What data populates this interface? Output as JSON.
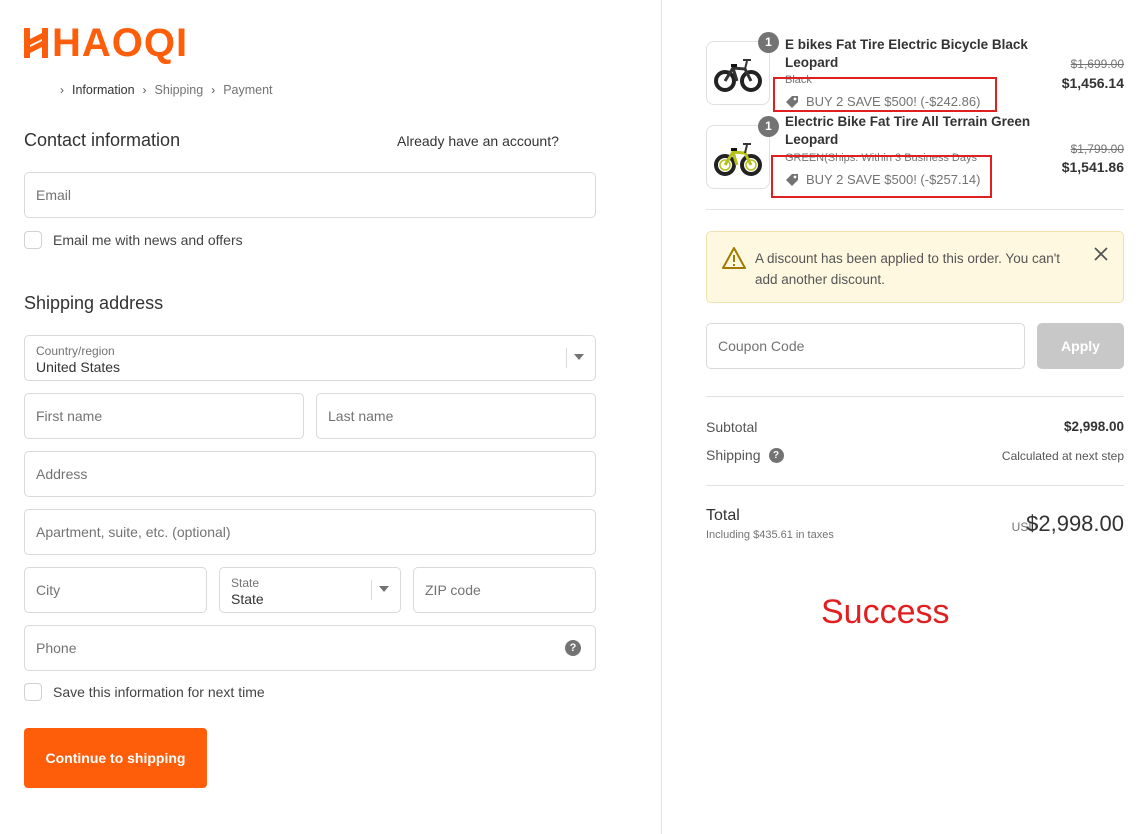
{
  "brand": {
    "name": "HAOQI",
    "color": "#fe5d0a"
  },
  "breadcrumb": [
    {
      "label": "Information",
      "active": true
    },
    {
      "label": "Shipping",
      "active": false
    },
    {
      "label": "Payment",
      "active": false
    }
  ],
  "contact": {
    "title": "Contact information",
    "login_prompt": "Already have an account?",
    "email_placeholder": "Email",
    "newsletter_label": "Email me with news and offers"
  },
  "shipping": {
    "title": "Shipping address",
    "country_label": "Country/region",
    "country_value": "United States",
    "first_name_placeholder": "First name",
    "last_name_placeholder": "Last name",
    "address_placeholder": "Address",
    "apartment_placeholder": "Apartment, suite, etc. (optional)",
    "city_placeholder": "City",
    "state_label": "State",
    "state_value": "State",
    "zip_placeholder": "ZIP code",
    "phone_placeholder": "Phone",
    "save_info_label": "Save this information for next time",
    "continue_label": "Continue to shipping"
  },
  "order": {
    "items": [
      {
        "qty": "1",
        "title_line1": "E bikes Fat Tire Electric Bicycle Black",
        "title_line2": "Leopard",
        "variant": "Black",
        "discount": "BUY 2 SAVE $500! (-$242.86)",
        "original_price": "$1,699.00",
        "price": "$1,456.14",
        "frame_color": "#333333"
      },
      {
        "qty": "1",
        "title_line1": "Electric Bike Fat Tire All Terrain Green",
        "title_line2": "Leopard",
        "variant": "GREEN(Ships. Within 3 Business Days",
        "discount": "BUY 2 SAVE $500! (-$257.14)",
        "original_price": "$1,799.00",
        "price": "$1,541.86",
        "frame_color": "#b5c21a"
      }
    ],
    "notice": "A discount has been applied to this order. You can't add another discount.",
    "coupon_placeholder": "Coupon Code",
    "apply_label": "Apply",
    "subtotal_label": "Subtotal",
    "subtotal_value": "$2,998.00",
    "shipping_label": "Shipping",
    "shipping_value": "Calculated at next step",
    "total_label": "Total",
    "tax_note": "Including $435.61 in taxes",
    "currency": "USD",
    "total_value": "$2,998.00"
  },
  "annotation": {
    "text": "Success",
    "color": "#e02020"
  }
}
